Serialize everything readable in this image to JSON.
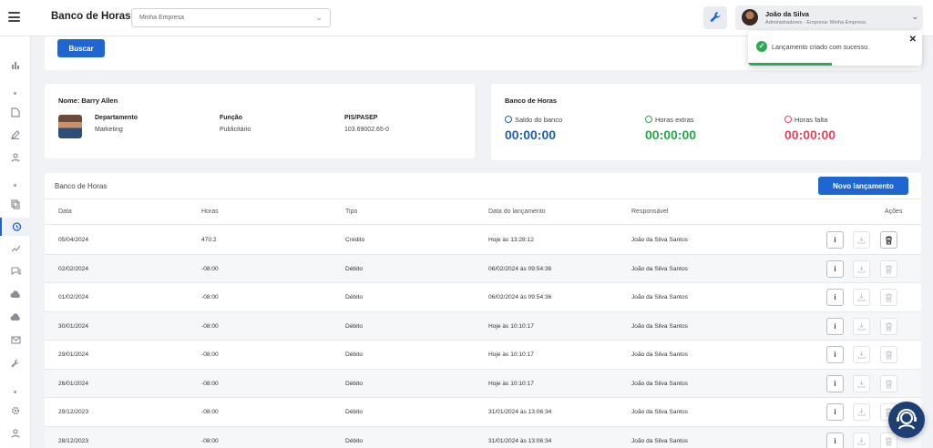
{
  "header": {
    "app_title": "Banco de Horas",
    "company_select_value": "Minha Empresa",
    "user_name": "João da Silva",
    "user_role": "Administradores - Empresa: Minha Empresa"
  },
  "search": {
    "button_label": "Buscar"
  },
  "employee": {
    "name_label": "Nome: Barry Allen",
    "department_label": "Departamento",
    "department_value": "Marketing",
    "function_label": "Função",
    "function_value": "Publicitário",
    "pis_label": "PIS/PASEP",
    "pis_value": "103.69002.65-0"
  },
  "hours_summary": {
    "title": "Banco de Horas",
    "balance_label": "Saldo do banco",
    "balance_value": "00:00:00",
    "extra_label": "Horas extras",
    "extra_value": "00:00:00",
    "missing_label": "Horas falta",
    "missing_value": "00:00:00"
  },
  "table": {
    "title": "Banco de Horas",
    "new_button_label": "Novo lançamento",
    "columns": [
      "Data",
      "Horas",
      "Tipo",
      "Data do lançamento",
      "Responsável",
      "Ações"
    ],
    "rows": [
      {
        "date": "05/04/2024",
        "hours": "470:2",
        "type": "Crédito",
        "entry_date": "Hoje às 13:28:12",
        "responsible": "João da Silva Santos",
        "deletable": true
      },
      {
        "date": "02/02/2024",
        "hours": "-08:00",
        "type": "Débito",
        "entry_date": "06/02/2024 às 09:54:36",
        "responsible": "João da Silva Santos",
        "deletable": false
      },
      {
        "date": "01/02/2024",
        "hours": "-08:00",
        "type": "Débito",
        "entry_date": "06/02/2024 às 09:54:36",
        "responsible": "João da Silva Santos",
        "deletable": false
      },
      {
        "date": "30/01/2024",
        "hours": "-08:00",
        "type": "Débito",
        "entry_date": "Hoje às 10:10:17",
        "responsible": "João da Silva Santos",
        "deletable": false
      },
      {
        "date": "29/01/2024",
        "hours": "-08:00",
        "type": "Débito",
        "entry_date": "Hoje às 10:10:17",
        "responsible": "João da Silva Santos",
        "deletable": false
      },
      {
        "date": "26/01/2024",
        "hours": "-08:00",
        "type": "Débito",
        "entry_date": "Hoje às 10:10:17",
        "responsible": "João da Silva Santos",
        "deletable": false
      },
      {
        "date": "29/12/2023",
        "hours": "-08:00",
        "type": "Débito",
        "entry_date": "31/01/2024 às 13:06:34",
        "responsible": "João da Silva Santos",
        "deletable": false
      },
      {
        "date": "28/12/2023",
        "hours": "-08:00",
        "type": "Débito",
        "entry_date": "31/01/2024 às 13:06:34",
        "responsible": "João da Silva Santos",
        "deletable": false
      }
    ]
  },
  "toast": {
    "message": "Lançamento criado com sucesso.",
    "progress": 0.48
  },
  "colors": {
    "primary": "#1f66d1",
    "success": "#2eaa56",
    "danger": "#e0455f",
    "balance": "#1f5fae",
    "extra": "#27a84a"
  }
}
